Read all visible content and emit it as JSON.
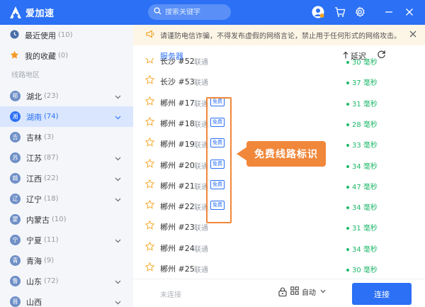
{
  "app": {
    "title": "爱加速"
  },
  "search": {
    "placeholder": "搜索关键字"
  },
  "sidebar": {
    "top_items": [
      {
        "label": "最近使用",
        "count": "(10)",
        "icon": "clock-icon"
      },
      {
        "label": "我的收藏",
        "count": "(0)",
        "icon": "star-icon"
      }
    ],
    "section_title": "线路地区",
    "provinces": [
      {
        "badge": "鄂",
        "label": "湖北",
        "count": "(23)",
        "expandable": true,
        "active": false
      },
      {
        "badge": "湘",
        "label": "湖南",
        "count": "(74)",
        "expandable": true,
        "active": true
      },
      {
        "badge": "吉",
        "label": "吉林",
        "count": "(3)",
        "expandable": false,
        "active": false
      },
      {
        "badge": "苏",
        "label": "江苏",
        "count": "(87)",
        "expandable": true,
        "active": false
      },
      {
        "badge": "赣",
        "label": "江西",
        "count": "(22)",
        "expandable": true,
        "active": false
      },
      {
        "badge": "辽",
        "label": "辽宁",
        "count": "(18)",
        "expandable": true,
        "active": false
      },
      {
        "badge": "蒙",
        "label": "内蒙古",
        "count": "(10)",
        "expandable": false,
        "active": false
      },
      {
        "badge": "宁",
        "label": "宁夏",
        "count": "(11)",
        "expandable": true,
        "active": false
      },
      {
        "badge": "青",
        "label": "青海",
        "count": "(9)",
        "expandable": false,
        "active": false
      },
      {
        "badge": "鲁",
        "label": "山东",
        "count": "(72)",
        "expandable": true,
        "active": false
      },
      {
        "badge": "晋",
        "label": "山西",
        "count": "",
        "expandable": true,
        "active": false
      }
    ]
  },
  "notice": {
    "text": "请谨防电信诈骗，不得发布虚假的网络言论，禁止用于任何形式的网络攻击。"
  },
  "list_header": {
    "servers_label": "服务器",
    "latency_label": "延迟"
  },
  "servers": [
    {
      "name": "长沙 #52",
      "isp": "联通",
      "free": false,
      "latency": "30 毫秒"
    },
    {
      "name": "长沙 #53",
      "isp": "联通",
      "free": false,
      "latency": "37 毫秒"
    },
    {
      "name": "郴州 #17",
      "isp": "联通",
      "free": true,
      "free_label": "免费",
      "latency": "31 毫秒"
    },
    {
      "name": "郴州 #18",
      "isp": "联通",
      "free": true,
      "free_label": "免费",
      "latency": "28 毫秒"
    },
    {
      "name": "郴州 #19",
      "isp": "联通",
      "free": true,
      "free_label": "免费",
      "latency": "33 毫秒"
    },
    {
      "name": "郴州 #20",
      "isp": "联通",
      "free": true,
      "free_label": "免费",
      "latency": "34 毫秒"
    },
    {
      "name": "郴州 #21",
      "isp": "联通",
      "free": true,
      "free_label": "免费",
      "latency": "47 毫秒"
    },
    {
      "name": "郴州 #22",
      "isp": "联通",
      "free": true,
      "free_label": "免费",
      "latency": "34 毫秒"
    },
    {
      "name": "郴州 #23",
      "isp": "联通",
      "free": false,
      "latency": "31 毫秒"
    },
    {
      "name": "郴州 #24",
      "isp": "联通",
      "free": false,
      "latency": "34 毫秒"
    },
    {
      "name": "郴州 #25",
      "isp": "联通",
      "free": false,
      "latency": "30 毫秒"
    }
  ],
  "annotation": {
    "callout_text": "免费线路标识"
  },
  "bottom": {
    "status": "未连接",
    "mode": "自动",
    "connect_label": "连接"
  },
  "colors": {
    "brand": "#2b70f5",
    "latency_good": "#1fb86a",
    "annotation": "#f0873a"
  }
}
